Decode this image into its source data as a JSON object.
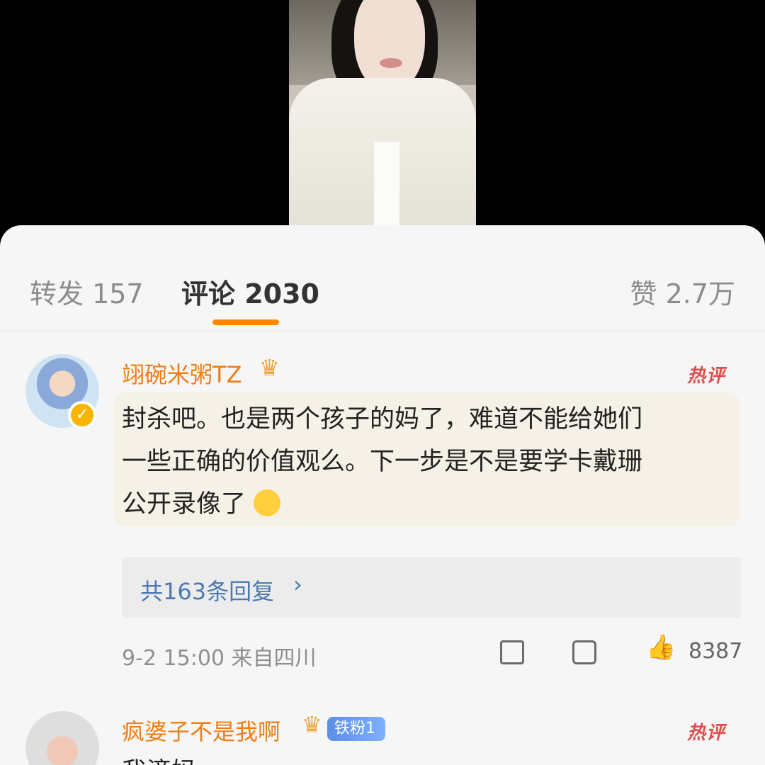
{
  "tabs": {
    "repost": "转发 157",
    "comment": "评论 2030",
    "like": "赞 2.7万"
  },
  "comments": [
    {
      "username": "翊碗米粥TZ",
      "hot_label": "热评",
      "text_line1": "封杀吧。也是两个孩子的妈了，难道不能给她们",
      "text_line2": "一些正确的价值观么。下一步是不是要学卡戴珊",
      "text_line3": "公开录像了",
      "replies_label": "共163条回复",
      "time_location": "9-2 15:00 来自四川",
      "like_count": "8387"
    },
    {
      "username": "疯婆子不是我啊",
      "badge": "铁粉1",
      "hot_label": "热评",
      "text_partial": "我滴妈"
    }
  ],
  "icons": [
    "share-icon",
    "comment-icon",
    "thumbs-up-icon",
    "crown-icon",
    "verified-icon",
    "chevron-right-icon",
    "laughing-emoji-icon"
  ]
}
